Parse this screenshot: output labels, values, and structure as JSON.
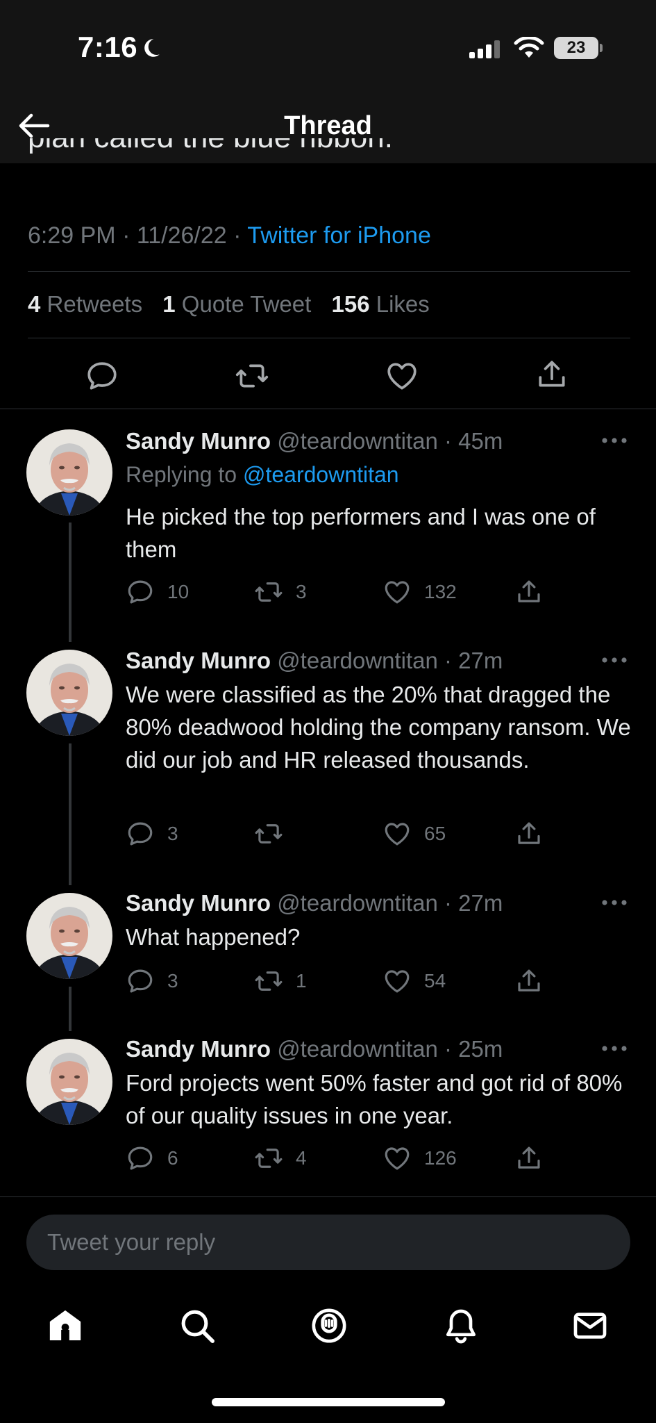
{
  "status_bar": {
    "time": "7:16",
    "battery": "23"
  },
  "header": {
    "title": "Thread"
  },
  "main_tweet": {
    "cut_text": "plan called the blue ribbon.",
    "time": "6:29 PM",
    "date": "11/26/22",
    "source": "Twitter for iPhone",
    "stats": {
      "retweets_count": "4",
      "retweets_label": "Retweets",
      "quotes_count": "1",
      "quotes_label": "Quote Tweet",
      "likes_count": "156",
      "likes_label": "Likes"
    }
  },
  "replies": [
    {
      "name": "Sandy Munro",
      "handle": "@teardowntitan",
      "time": "45m",
      "replying_prefix": "Replying to",
      "replying_handle": "@teardowntitan",
      "text": "He picked the top performers and I was one of them",
      "replies": "10",
      "retweets": "3",
      "likes": "132"
    },
    {
      "name": "Sandy Munro",
      "handle": "@teardowntitan",
      "time": "27m",
      "text": "We were classified as the 20% that dragged the 80% deadwood holding the company ransom. We did our job and HR released thousands.",
      "replies": "3",
      "retweets": "",
      "likes": "65"
    },
    {
      "name": "Sandy Munro",
      "handle": "@teardowntitan",
      "time": "27m",
      "text": "What happened?",
      "replies": "3",
      "retweets": "1",
      "likes": "54"
    },
    {
      "name": "Sandy Munro",
      "handle": "@teardowntitan",
      "time": "25m",
      "text": "Ford projects went 50% faster and got rid of 80% of our quality issues in one year.",
      "replies": "6",
      "retweets": "4",
      "likes": "126"
    }
  ],
  "composer": {
    "placeholder": "Tweet your reply"
  },
  "colors": {
    "background": "#000000",
    "accent": "#1d9bf0",
    "muted": "#71767b",
    "header": "#141414"
  },
  "icons": [
    "back-arrow-icon",
    "reply-icon",
    "retweet-icon",
    "like-icon",
    "share-icon",
    "more-icon",
    "home-icon",
    "search-icon",
    "spaces-icon",
    "notifications-icon",
    "messages-icon"
  ]
}
